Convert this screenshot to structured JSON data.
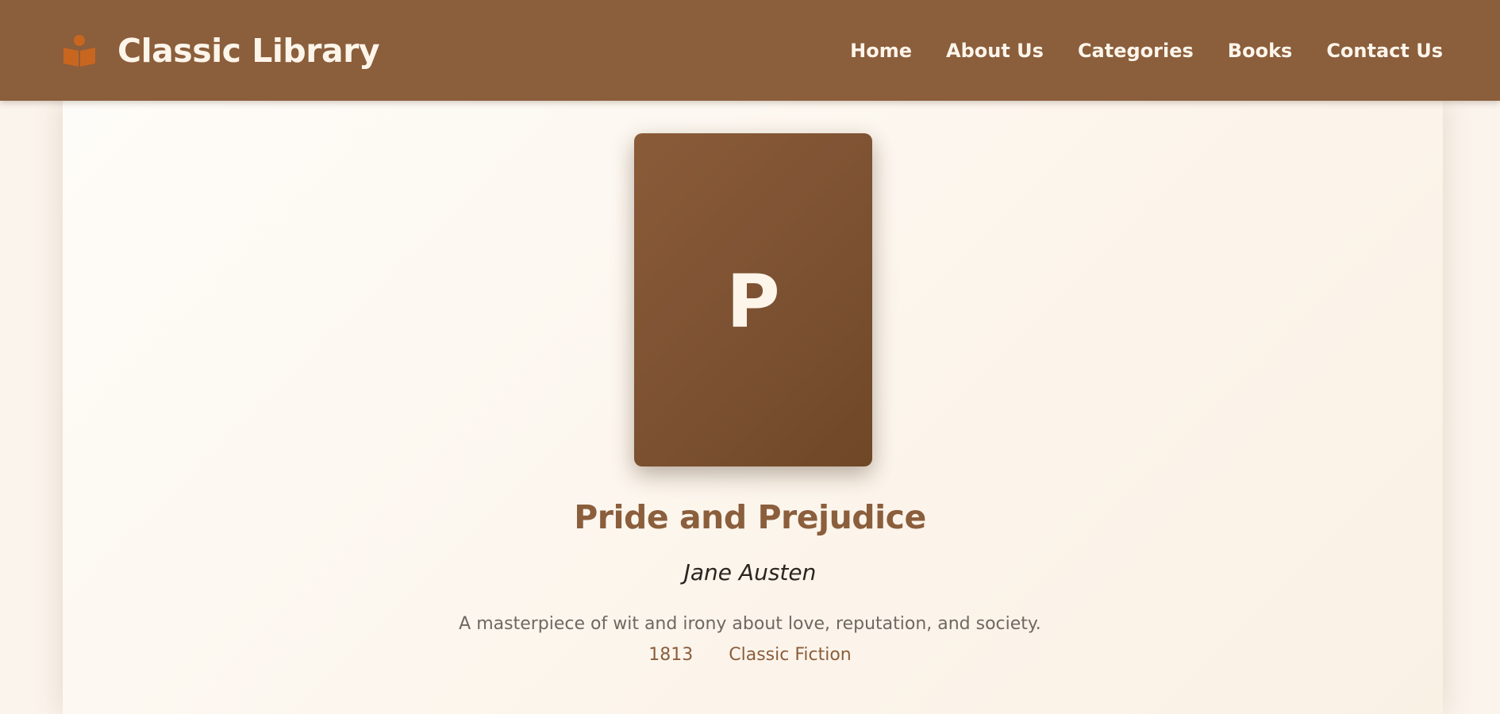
{
  "header": {
    "logo_icon": "book-reader-icon",
    "brand_name": "Classic Library",
    "nav": [
      "Home",
      "About Us",
      "Categories",
      "Books",
      "Contact Us"
    ]
  },
  "book": {
    "cover_letter": "P",
    "title": "Pride and Prejudice",
    "author": "Jane Austen",
    "description": "A masterpiece of wit and irony about love, reputation, and society.",
    "year": "1813",
    "category": "Classic Fiction"
  },
  "colors": {
    "header_bg": "#8b5e3c",
    "logo_accent": "#c8661f",
    "title_color": "#8b5e3c",
    "page_bg": "#fbf4ec",
    "header_text": "#fdf5ea"
  }
}
